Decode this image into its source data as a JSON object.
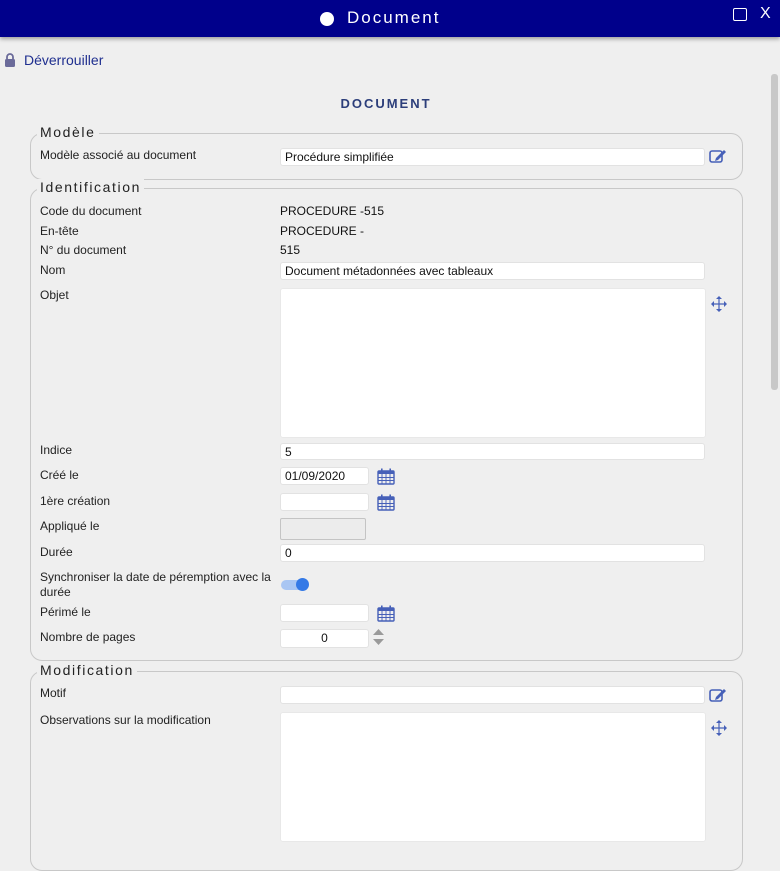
{
  "window": {
    "title": "Document",
    "maximize_icon": "maximize-icon",
    "close_label": "X"
  },
  "unlock": {
    "label": "Déverrouiller",
    "icon": "lock-icon"
  },
  "page_title": "DOCUMENT",
  "modele": {
    "legend": "Modèle",
    "template_label": "Modèle associé au document",
    "template_value": "Procédure simplifiée"
  },
  "identification": {
    "legend": "Identification",
    "code_label": "Code du document",
    "code_value": "PROCEDURE -515",
    "header_label": "En-tête",
    "header_value": "PROCEDURE -",
    "number_label": "N° du document",
    "number_value": "515",
    "name_label": "Nom",
    "name_value": "Document métadonnées avec tableaux",
    "object_label": "Objet",
    "object_value": "",
    "index_label": "Indice",
    "index_value": "5",
    "created_label": "Créé le",
    "created_value": "01/09/2020",
    "first_creation_label": "1ère création",
    "first_creation_value": "",
    "applied_label": "Appliqué le",
    "applied_value": "",
    "duration_label": "Durée",
    "duration_value": "0",
    "sync_label": "Synchroniser la date de péremption avec la durée",
    "sync_on": true,
    "expired_label": "Périmé le",
    "expired_value": "",
    "pages_label": "Nombre de pages",
    "pages_value": "0"
  },
  "modification": {
    "legend": "Modification",
    "reason_label": "Motif",
    "reason_value": "",
    "observations_label": "Observations sur la modification",
    "observations_value": ""
  },
  "colors": {
    "titlebar": "#00008b",
    "accent": "#3479e6",
    "icon_blue": "#4660b8",
    "heading": "#2c3e7a"
  }
}
